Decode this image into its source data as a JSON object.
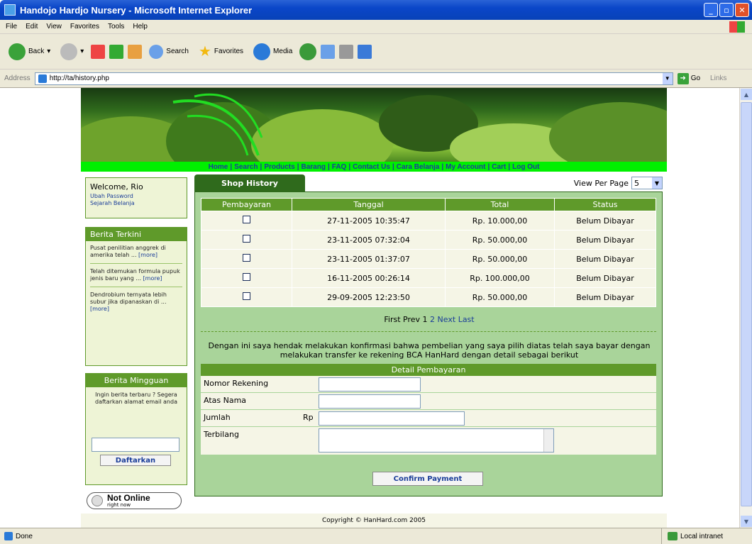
{
  "browser": {
    "title": "Handojo Hardjo Nursery - Microsoft Internet Explorer",
    "menu": [
      "File",
      "Edit",
      "View",
      "Favorites",
      "Tools",
      "Help"
    ],
    "toolbar": {
      "back": "Back",
      "search": "Search",
      "favorites": "Favorites",
      "media": "Media"
    },
    "address_label": "Address",
    "url": "http://ta/history.php",
    "go": "Go",
    "links": "Links",
    "status": "Done",
    "zone": "Local intranet"
  },
  "nav": {
    "items": [
      "Home",
      "Search",
      "Products",
      "Barang",
      "FAQ",
      "Contact Us",
      "Cara Belanja",
      "My Account",
      "Cart",
      "Log Out"
    ]
  },
  "sidebar": {
    "welcome": "Welcome, Rio",
    "links": [
      "Ubah Password",
      "Sejarah Belanja"
    ],
    "news_title": "Berita Terkini",
    "news": [
      {
        "text": "Pusat penilitian anggrek di amerika telah ...",
        "more": "[more]"
      },
      {
        "text": "Telah ditemukan formula pupuk jenis baru yang ...",
        "more": "[more]"
      },
      {
        "text": "Dendrobium ternyata lebih subur jika dipanaskan di ...",
        "more": "[more]"
      }
    ],
    "weekly_title": "Berita Mingguan",
    "weekly_text": "Ingin berita terbaru ? Segera daftarkan alamat email anda",
    "register_button": "Daftarkan",
    "online_status": "Not Online",
    "online_sub": "right now"
  },
  "history": {
    "tab": "Shop History",
    "view_per_page_label": "View Per Page",
    "view_per_page_value": "5",
    "columns": [
      "Pembayaran",
      "Tanggal",
      "Total",
      "Status"
    ],
    "rows": [
      {
        "date": "27-11-2005 10:35:47",
        "total": "Rp. 10.000,00",
        "status": "Belum Dibayar"
      },
      {
        "date": "23-11-2005 07:32:04",
        "total": "Rp. 50.000,00",
        "status": "Belum Dibayar"
      },
      {
        "date": "23-11-2005 01:37:07",
        "total": "Rp. 50.000,00",
        "status": "Belum Dibayar"
      },
      {
        "date": "16-11-2005 00:26:14",
        "total": "Rp. 100.000,00",
        "status": "Belum Dibayar"
      },
      {
        "date": "29-09-2005 12:23:50",
        "total": "Rp. 50.000,00",
        "status": "Belum Dibayar"
      }
    ],
    "pager": {
      "first": "First",
      "prev": "Prev",
      "current": "1",
      "page2": "2",
      "next": "Next",
      "last": "Last"
    },
    "confirm_text": "Dengan ini saya hendak melakukan konfirmasi bahwa pembelian yang saya pilih diatas telah saya bayar dengan melakukan transfer ke rekening BCA HanHard dengan detail sebagai berikut"
  },
  "payment": {
    "title": "Detail Pembayaran",
    "account_label": "Nomor Rekening",
    "name_label": "Atas Nama",
    "amount_label": "Jumlah",
    "currency": "Rp",
    "words_label": "Terbilang",
    "confirm_button": "Confirm Payment"
  },
  "footer": "Copyright © HanHard.com 2005"
}
